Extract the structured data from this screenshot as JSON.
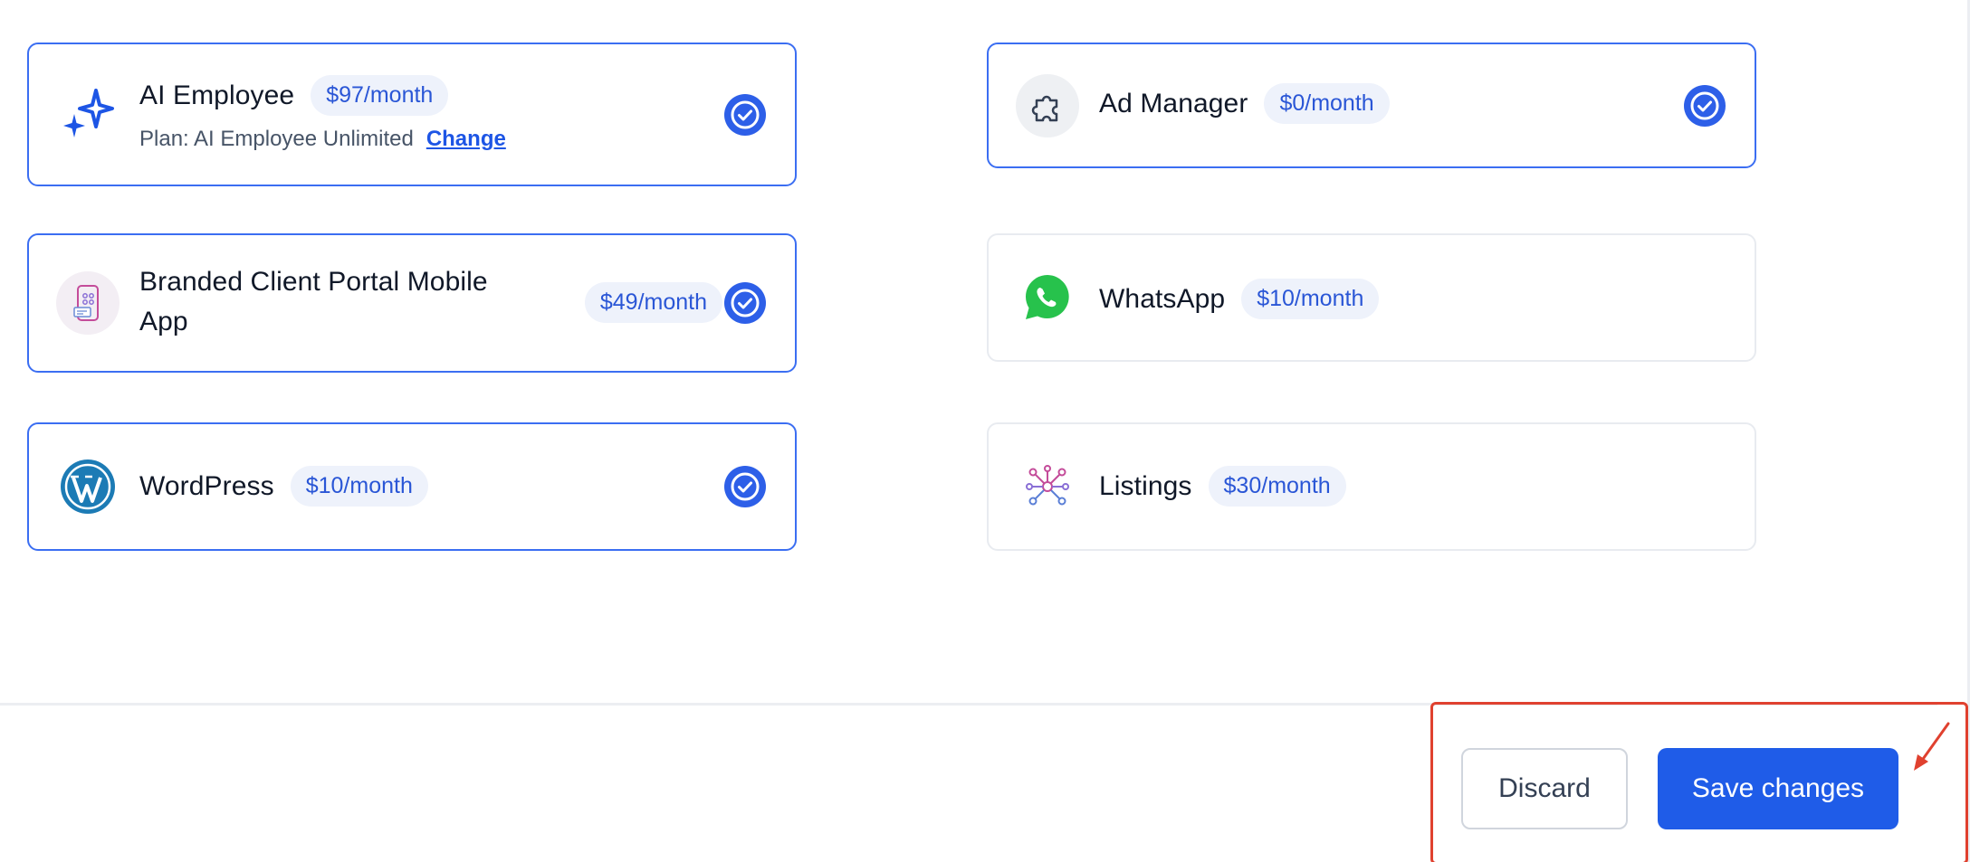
{
  "addons": {
    "ai_employee": {
      "title": "AI Employee",
      "price": "$97/month",
      "plan_label": "Plan: AI Employee Unlimited",
      "change_label": "Change",
      "selected": true,
      "icon": "sparkle-icon"
    },
    "ad_manager": {
      "title": "Ad Manager",
      "price": "$0/month",
      "selected": true,
      "icon": "puzzle-icon"
    },
    "client_portal": {
      "title": "Branded Client Portal Mobile App",
      "price": "$49/month",
      "selected": true,
      "icon": "mobile-app-icon"
    },
    "whatsapp": {
      "title": "WhatsApp",
      "price": "$10/month",
      "selected": false,
      "icon": "whatsapp-icon"
    },
    "wordpress": {
      "title": "WordPress",
      "price": "$10/month",
      "selected": true,
      "icon": "wordpress-icon"
    },
    "listings": {
      "title": "Listings",
      "price": "$30/month",
      "selected": false,
      "icon": "network-icon"
    }
  },
  "footer": {
    "discard_label": "Discard",
    "save_label": "Save changes"
  },
  "colors": {
    "accent": "#1f5ce8",
    "selected_border": "#3b6ef2",
    "price_pill_bg": "#eef2fb",
    "annotation": "#e0412f"
  }
}
